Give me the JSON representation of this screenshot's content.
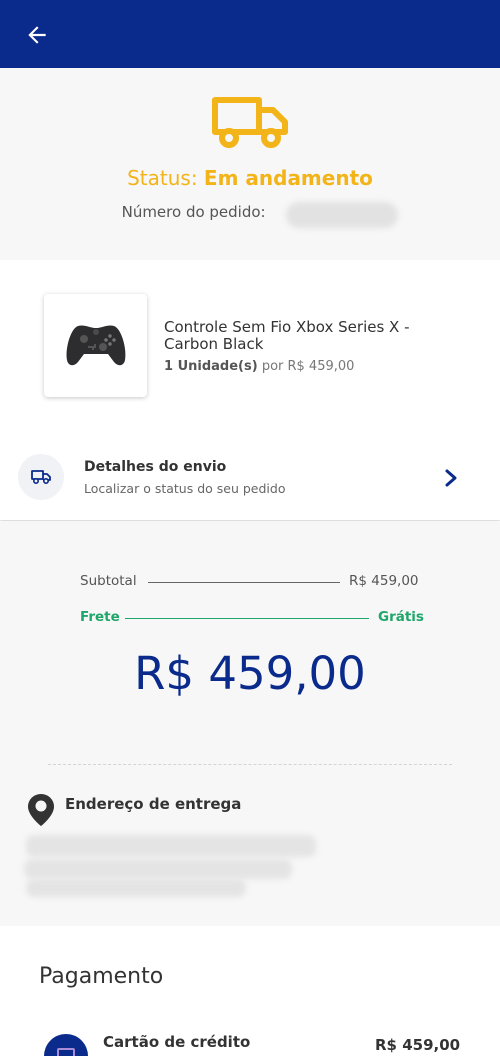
{
  "colors": {
    "brand": "#0a2a8c",
    "status": "#f2b418",
    "free": "#1fa66a"
  },
  "status": {
    "label": "Status:",
    "value": "Em andamento",
    "order_label": "Número do pedido:"
  },
  "product": {
    "name": "Controle Sem Fio Xbox Series X - Carbon Black",
    "quantity": "1 Unidade(s)",
    "price_text": "por R$ 459,00"
  },
  "shipping": {
    "title": "Detalhes do envio",
    "subtitle": "Localizar o status do seu pedido"
  },
  "summary": {
    "subtotal_label": "Subtotal",
    "subtotal_value": "R$ 459,00",
    "freight_label": "Frete",
    "freight_value": "Grátis",
    "total": "R$ 459,00"
  },
  "address": {
    "title": "Endereço de entrega"
  },
  "payment": {
    "title": "Pagamento",
    "method": "Cartão de crédito",
    "amount": "R$ 459,00"
  }
}
